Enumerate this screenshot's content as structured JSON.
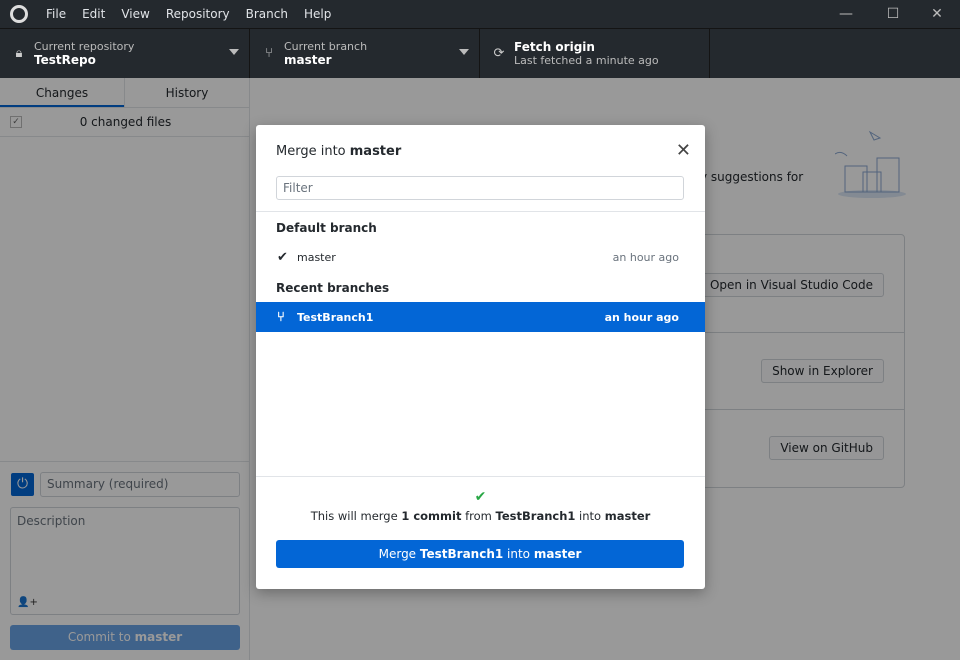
{
  "menu": [
    "File",
    "Edit",
    "View",
    "Repository",
    "Branch",
    "Help"
  ],
  "toolbar": {
    "repo": {
      "label": "Current repository",
      "value": "TestRepo"
    },
    "branch": {
      "label": "Current branch",
      "value": "master"
    },
    "fetch": {
      "label": "Fetch origin",
      "sub": "Last fetched a minute ago"
    }
  },
  "sidebar": {
    "tabs": [
      "Changes",
      "History"
    ],
    "changed": "0 changed files",
    "summary_placeholder": "Summary (required)",
    "description_placeholder": "Description",
    "commit_prefix": "Commit to ",
    "commit_branch": "master"
  },
  "main": {
    "suggestion_fragment": "y suggestions for",
    "buttons": [
      "Open in Visual Studio Code",
      "Show in Explorer",
      "View on GitHub"
    ]
  },
  "dialog": {
    "title_prefix": "Merge into ",
    "title_branch": "master",
    "filter_placeholder": "Filter",
    "default_header": "Default branch",
    "default_branch": {
      "name": "master",
      "time": "an hour ago"
    },
    "recent_header": "Recent branches",
    "recent_branch": {
      "name": "TestBranch1",
      "time": "an hour ago"
    },
    "msg": {
      "a": "This will merge ",
      "b": "1 commit",
      "c": " from ",
      "d": "TestBranch1",
      "e": " into ",
      "f": "master"
    },
    "button": {
      "a": "Merge ",
      "b": "TestBranch1",
      "c": " into ",
      "d": "master"
    }
  },
  "colors": {
    "accent": "#0366d6",
    "toolbar": "#24292e",
    "success": "#28a745"
  }
}
